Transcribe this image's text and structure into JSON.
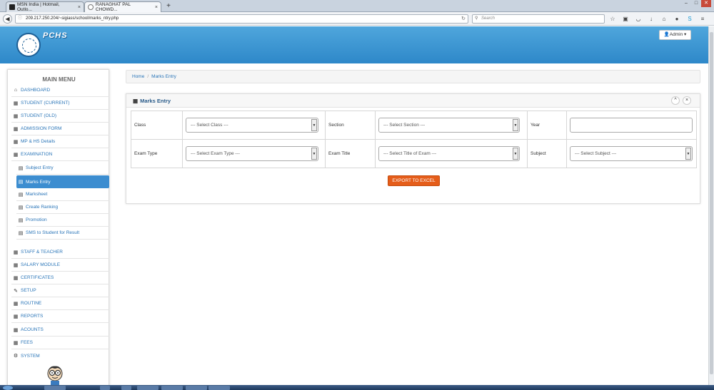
{
  "browser": {
    "tabs": [
      {
        "label": "MSN India | Hotmail, Outlo...",
        "close": "×"
      },
      {
        "label": "RANAGHAT PAL CHOWD...",
        "close": "×"
      }
    ],
    "new_tab": "+",
    "url": "209.217.250.204/~sigiass/school/marks_ntry.php",
    "search_placeholder": "Search"
  },
  "header": {
    "brand": "PCHS",
    "admin_button": "Admin ▾"
  },
  "sidebar": {
    "title": "MAIN MENU",
    "items": [
      {
        "label": "DASHBOARD",
        "icon": "home-icon",
        "glyph": "⌂"
      },
      {
        "label": "STUDENT (CURRENT)",
        "icon": "grid-icon",
        "glyph": "▦"
      },
      {
        "label": "STUDENT (OLD)",
        "icon": "grid-icon",
        "glyph": "▦"
      },
      {
        "label": "ADMISSION FORM",
        "icon": "grid-icon",
        "glyph": "▦"
      },
      {
        "label": "MP & HS Details",
        "icon": "grid-icon",
        "glyph": "▦"
      },
      {
        "label": "EXAMINATION",
        "icon": "grid-icon",
        "glyph": "▦"
      },
      {
        "label": "Subject Entry",
        "icon": "list-icon",
        "glyph": "▤"
      },
      {
        "label": "Marks Entry",
        "icon": "list-icon",
        "glyph": "▤"
      },
      {
        "label": "Marksheet",
        "icon": "list-icon",
        "glyph": "▤"
      },
      {
        "label": "Create Ranking",
        "icon": "list-icon",
        "glyph": "▤"
      },
      {
        "label": "Promotion",
        "icon": "list-icon",
        "glyph": "▤"
      },
      {
        "label": "SMS to Student for Result",
        "icon": "list-icon",
        "glyph": "▤"
      },
      {
        "label": "STAFF & TEACHER",
        "icon": "grid-icon",
        "glyph": "▦"
      },
      {
        "label": "SALARY MODULE",
        "icon": "grid-icon",
        "glyph": "▦"
      },
      {
        "label": "CERTIFICATES",
        "icon": "grid-icon",
        "glyph": "▦"
      },
      {
        "label": "SETUP",
        "icon": "wrench-icon",
        "glyph": "✎"
      },
      {
        "label": "ROUTINE",
        "icon": "grid-icon",
        "glyph": "▦"
      },
      {
        "label": "REPORTS",
        "icon": "grid-icon",
        "glyph": "▦"
      },
      {
        "label": "ACOUNTS",
        "icon": "grid-icon",
        "glyph": "▦"
      },
      {
        "label": "FEES",
        "icon": "grid-icon",
        "glyph": "▦"
      },
      {
        "label": "SYSTEM",
        "icon": "cogs-icon",
        "glyph": "⚙"
      }
    ]
  },
  "breadcrumb": {
    "home": "Home",
    "separator": "/",
    "current": "Marks Entry"
  },
  "panel": {
    "title": "Marks Entry",
    "collapse": "^",
    "close": "×"
  },
  "form": {
    "class_label": "Class",
    "class_value": "--- Select Class ---",
    "section_label": "Section",
    "section_value": "--- Select Section ---",
    "year_label": "Year",
    "year_value": "",
    "exam_type_label": "Exam Type",
    "exam_type_value": "--- Select Exam Type ---",
    "exam_title_label": "Exam Title",
    "exam_title_value": "--- Select Title of Exam ---",
    "subject_label": "Subject",
    "subject_value": "--- Select Subject ---",
    "export_button": "EXPORT TO EXCEL"
  },
  "colors": {
    "header_blue": "#2e88c9",
    "active_item": "#3c8dd0",
    "export_orange": "#e55d1a",
    "link_blue": "#2a75b8"
  }
}
